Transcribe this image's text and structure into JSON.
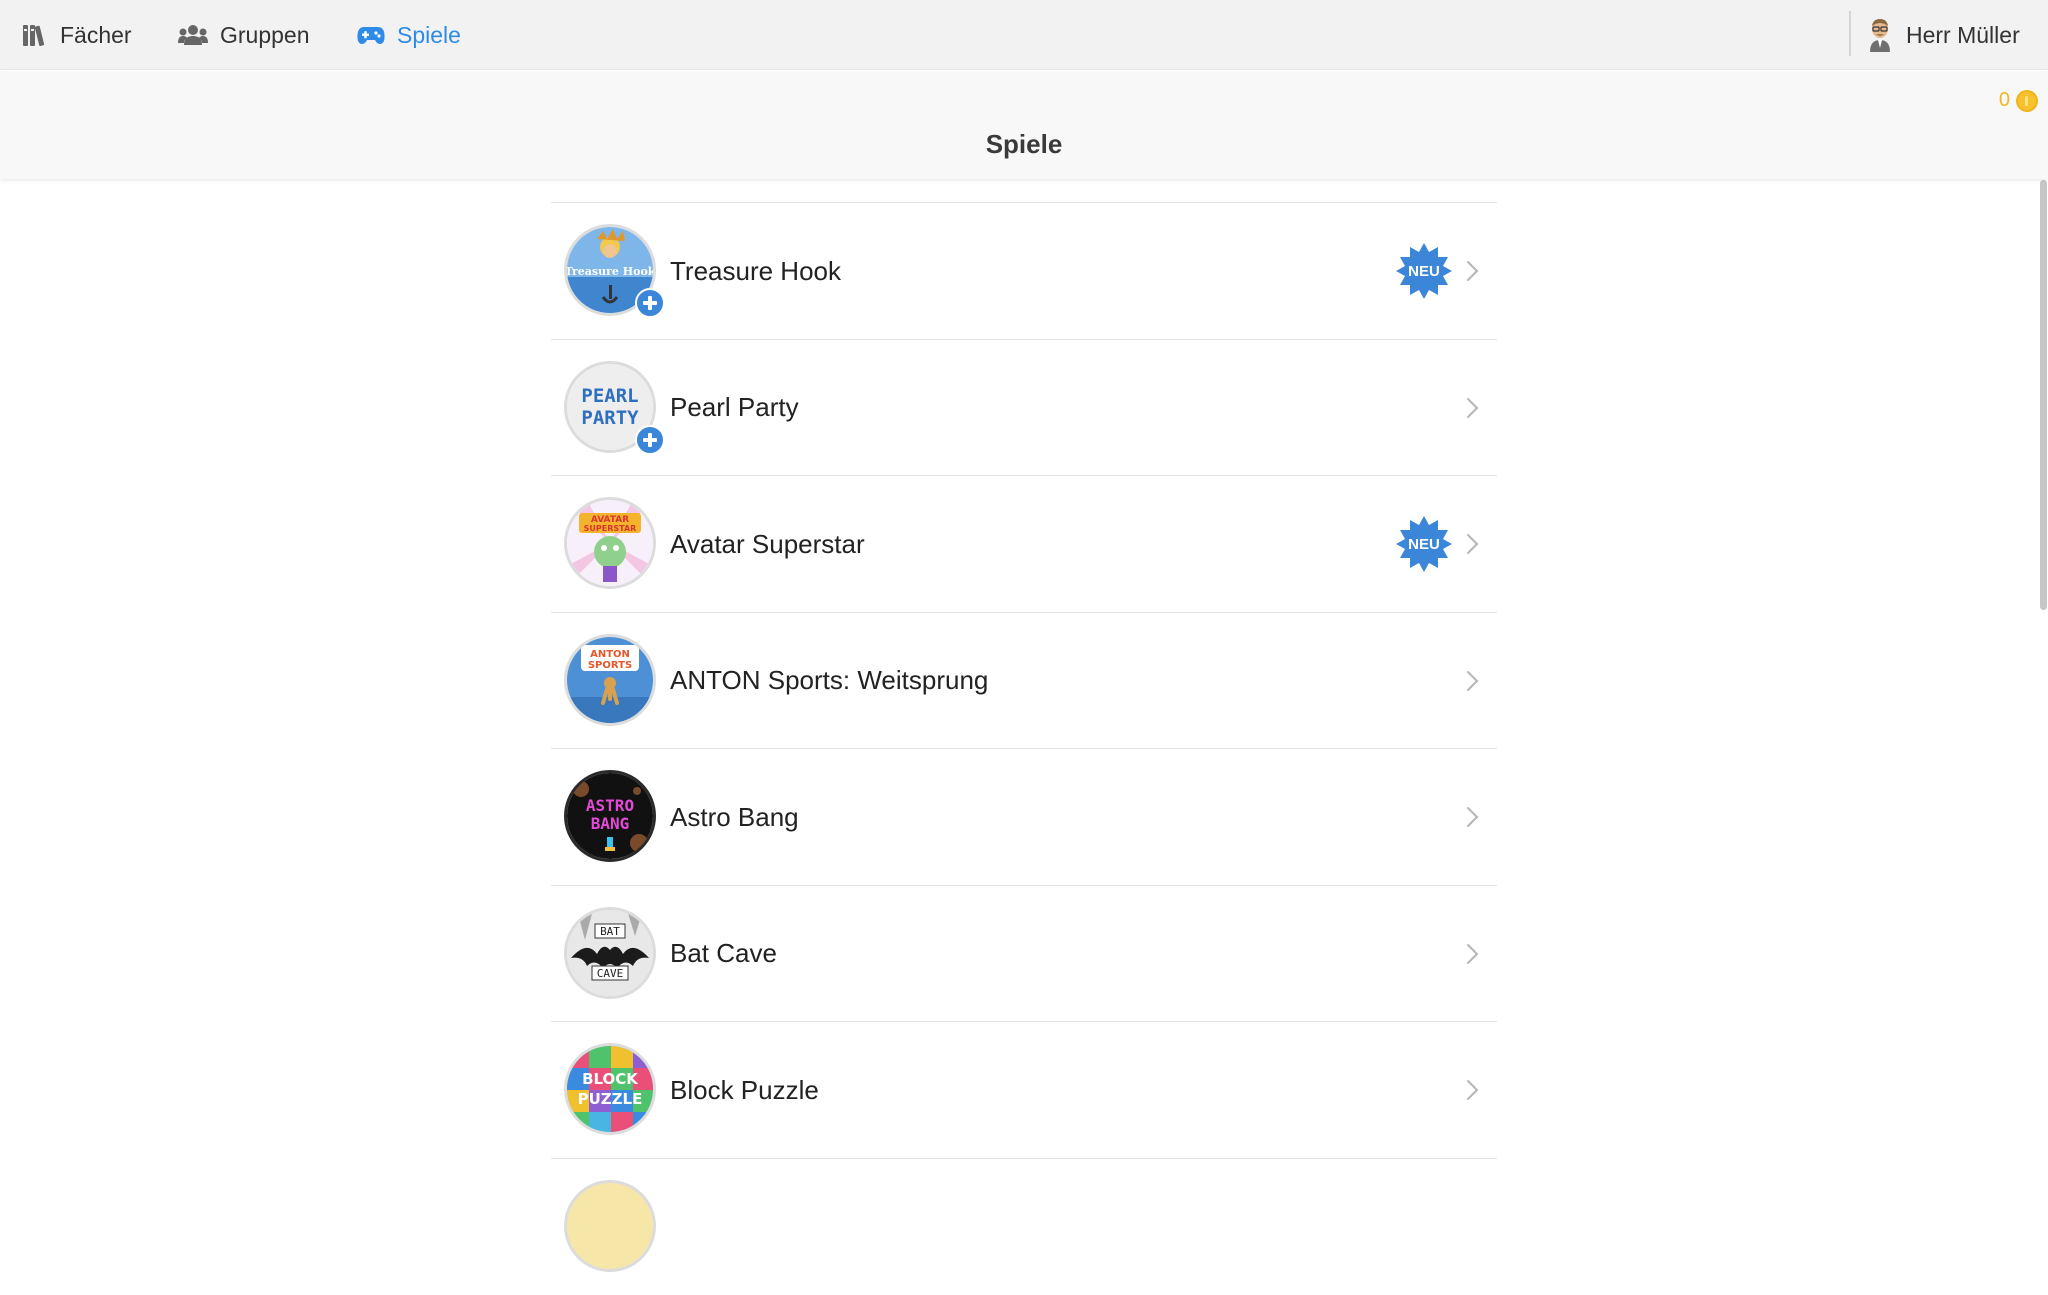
{
  "nav": {
    "items": [
      {
        "label": "Fächer",
        "icon": "books-icon",
        "active": false
      },
      {
        "label": "Gruppen",
        "icon": "users-icon",
        "active": false
      },
      {
        "label": "Spiele",
        "icon": "gamepad-icon",
        "active": true
      }
    ],
    "user": {
      "name": "Herr Müller",
      "icon": "teacher-avatar-icon"
    }
  },
  "header": {
    "title": "Spiele",
    "coins": "0"
  },
  "colors": {
    "accent": "#2e8be8",
    "badge_blue": "#3b86d8",
    "coin": "#f7c22b"
  },
  "games": [
    {
      "title": "Treasure Hook",
      "icon_text": "Treasure Hook",
      "has_plus": true,
      "badge": "NEU"
    },
    {
      "title": "Pearl Party",
      "icon_text": "PEARL PARTY",
      "has_plus": true,
      "badge": ""
    },
    {
      "title": "Avatar Superstar",
      "icon_text": "AVATAR SUPERSTAR",
      "has_plus": false,
      "badge": "NEU"
    },
    {
      "title": "ANTON Sports: Weitsprung",
      "icon_text": "ANTON SPORTS",
      "has_plus": false,
      "badge": ""
    },
    {
      "title": "Astro Bang",
      "icon_text": "ASTRO BANG",
      "has_plus": false,
      "badge": ""
    },
    {
      "title": "Bat Cave",
      "icon_text": "BAT CAVE",
      "has_plus": false,
      "badge": ""
    },
    {
      "title": "Block Puzzle",
      "icon_text": "BLOCK PUZZLE",
      "has_plus": false,
      "badge": ""
    }
  ]
}
